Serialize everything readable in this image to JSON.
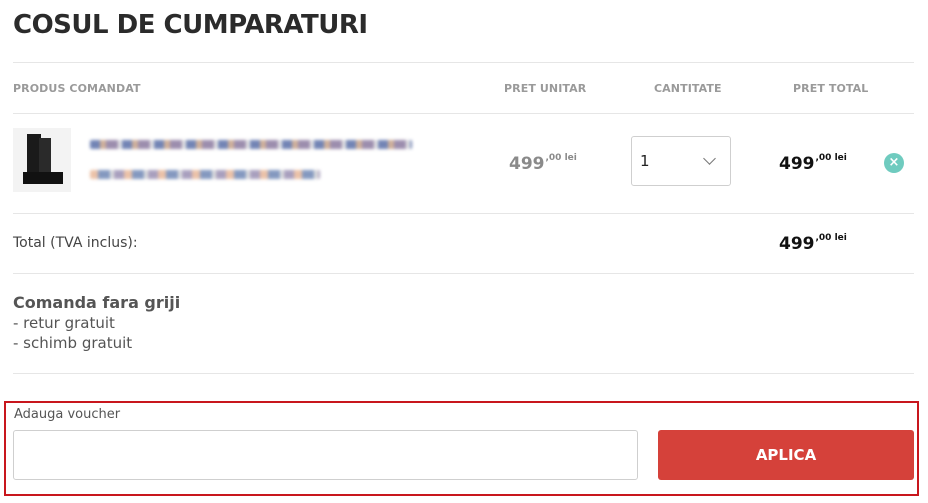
{
  "page": {
    "title": "COSUL DE CUMPARATURI"
  },
  "table": {
    "headers": {
      "product": "PRODUS COMANDAT",
      "unit_price": "PRET UNITAR",
      "quantity": "CANTITATE",
      "total_price": "PRET TOTAL"
    },
    "item": {
      "unit_price_main": "499",
      "unit_price_sup": ",00 lei",
      "quantity": "1",
      "total_price_main": "499",
      "total_price_sup": ",00 lei",
      "remove_icon": "×"
    }
  },
  "summary": {
    "total_label": "Total (TVA inclus):",
    "total_main": "499",
    "total_sup": ",00 lei"
  },
  "worry_free": {
    "title": "Comanda fara griji",
    "lines": [
      "- retur gratuit",
      "- schimb gratuit"
    ]
  },
  "voucher": {
    "label": "Adauga voucher",
    "value": "",
    "placeholder": "",
    "apply_label": "APLICA"
  },
  "icons": {
    "remove": "close-circle-icon",
    "chevron": "chevron-down-icon"
  },
  "colors": {
    "remove_button": "#6fcbbf",
    "apply_button": "#d5413a",
    "voucher_highlight": "#c8161d"
  }
}
